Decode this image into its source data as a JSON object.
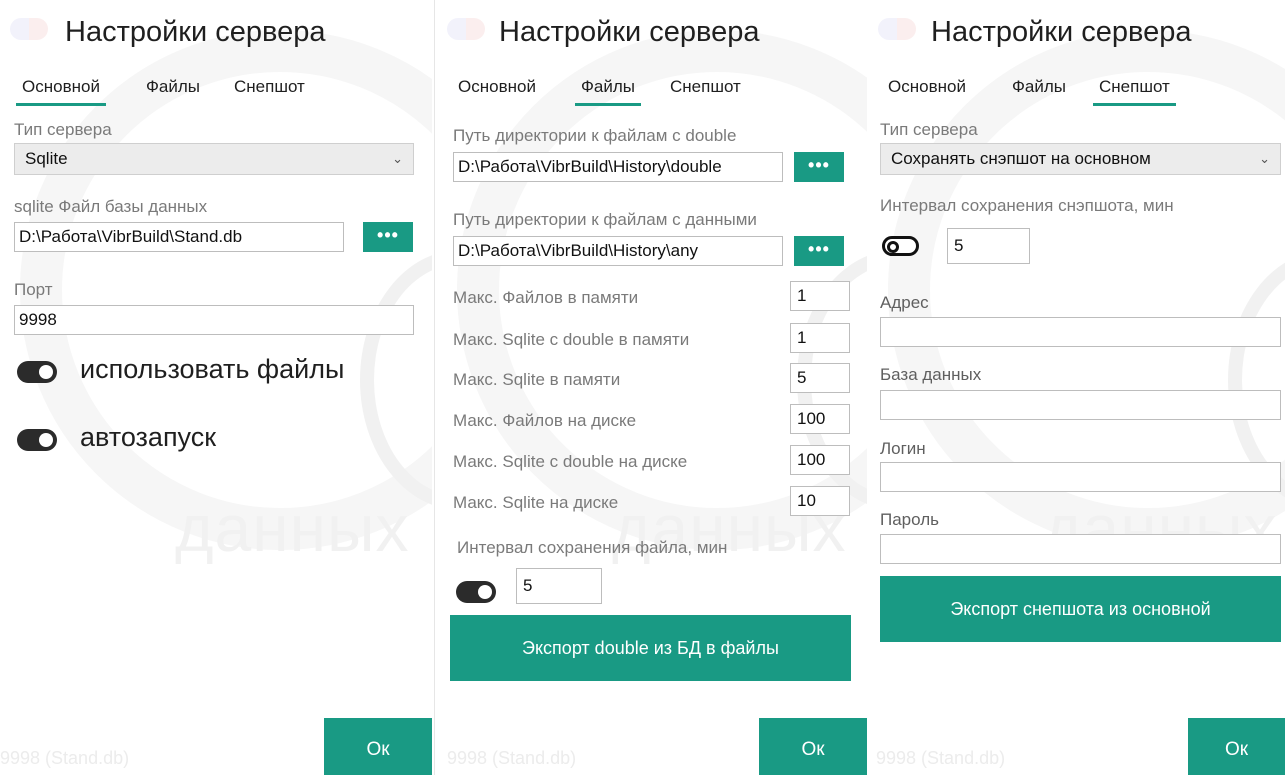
{
  "window_title": "Настройки сервера",
  "tabs": [
    "Основной",
    "Файлы",
    "Снепшот"
  ],
  "watermark": "данных",
  "ok_label": "Ок",
  "status_text": "9998 (Stand.db)",
  "dots_label": "•••",
  "colors": {
    "accent": "#199a84",
    "toggle_on": "#2b2b2b"
  },
  "main": {
    "server_type_label": "Тип сервера",
    "server_type_value": "Sqlite",
    "db_file_label": "sqlite Файл базы данных",
    "db_file_value": "D:\\Работа\\VibrBuild\\Stand.db",
    "port_label": "Порт",
    "port_value": "9998",
    "use_files_label": "использовать файлы",
    "use_files_on": true,
    "autostart_label": "автозапуск",
    "autostart_on": true
  },
  "files": {
    "double_dir_label": "Путь директории к файлам с double",
    "double_dir_value": "D:\\Работа\\VibrBuild\\History\\double",
    "data_dir_label": "Путь директории к файлам с данными",
    "data_dir_value": "D:\\Работа\\VibrBuild\\History\\any",
    "limits": [
      {
        "label": "Макс. Файлов в памяти",
        "value": "1"
      },
      {
        "label": "Макс. Sqlite с double в памяти",
        "value": "1"
      },
      {
        "label": "Макс. Sqlite в памяти",
        "value": "5"
      },
      {
        "label": "Макс. Файлов на диске",
        "value": "100"
      },
      {
        "label": "Макс. Sqlite с double на диске",
        "value": "100"
      },
      {
        "label": "Макс. Sqlite на диске",
        "value": "10"
      }
    ],
    "save_interval_label": "Интервал сохранения файла, мин",
    "save_interval_value": "5",
    "save_toggle_on": true,
    "export_button": "Экспорт double из БД в файлы"
  },
  "snapshot": {
    "server_type_label": "Тип сервера",
    "server_type_value": "Сохранять снэпшот на основном",
    "interval_label": "Интервал сохранения снэпшота, мин",
    "interval_value": "5",
    "interval_toggle_on": false,
    "address_label": "Адрес",
    "address_value": "",
    "database_label": "База данных",
    "database_value": "",
    "login_label": "Логин",
    "login_value": "",
    "password_label": "Пароль",
    "password_value": "",
    "export_button": "Экспорт снепшота из основной"
  }
}
